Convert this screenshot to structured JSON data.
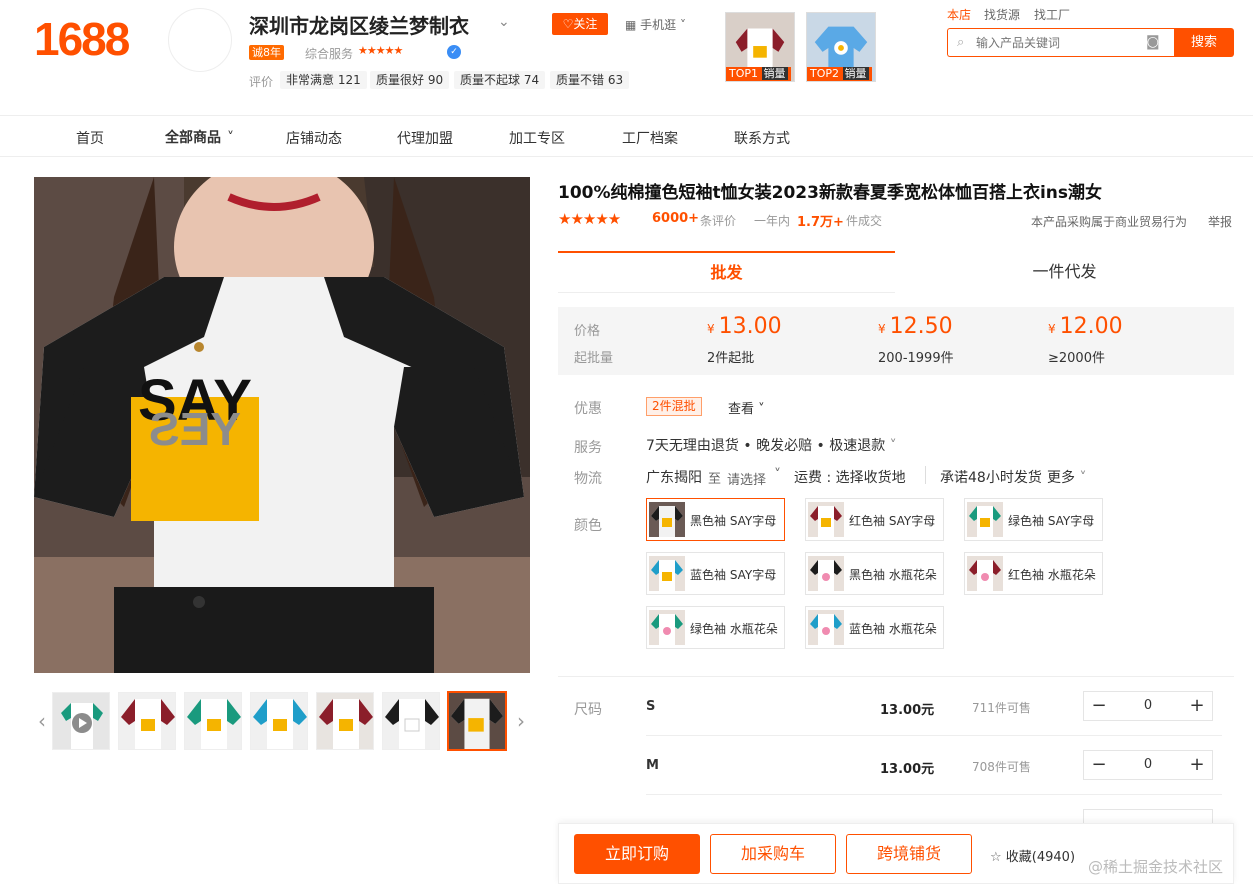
{
  "header": {
    "logo": "1688",
    "shop_name": "深圳市龙岗区绫兰梦制衣",
    "years_badge": "诚8年",
    "service_label": "综合服务",
    "service_stars": "★★★★★",
    "follow_label": "关注",
    "mobile_label": "手机逛",
    "review_label": "评价",
    "reviews": [
      "非常满意 121",
      "质量很好 90",
      "质量不起球 74",
      "质量不错 63"
    ],
    "top_items": [
      {
        "tag": "TOP1",
        "label": "销量"
      },
      {
        "tag": "TOP2",
        "label": "销量"
      }
    ],
    "search_scopes": [
      "本店",
      "找货源",
      "找工厂"
    ],
    "search_placeholder": "输入产品关键词",
    "search_button": "搜索"
  },
  "nav": {
    "items": [
      "首页",
      "全部商品",
      "店铺动态",
      "代理加盟",
      "加工专区",
      "工厂档案",
      "联系方式"
    ]
  },
  "product": {
    "title": "100%纯棉撞色短袖t恤女装2023新款春夏季宽松体恤百搭上衣ins潮女",
    "rating_stars": "★★★★★",
    "review_count": "6000+",
    "review_suffix": "条评价",
    "year_prefix": "一年内",
    "year_sales": "1.7万+",
    "deal_suffix": "件成交",
    "notice": "本产品采购属于商业贸易行为",
    "report": "举报",
    "tabs": [
      "批发",
      "一件代发"
    ],
    "price_label": "价格",
    "moq_label": "起批量",
    "currency": "¥",
    "tiers": [
      {
        "price": "13.00",
        "qty": "2件起批"
      },
      {
        "price": "12.50",
        "qty": "200-1999件"
      },
      {
        "price": "12.00",
        "qty": "≥2000件"
      }
    ],
    "promo_label": "优惠",
    "promo_tag": "2件混批",
    "promo_link": "查看",
    "service_label": "服务",
    "service_text": "7天无理由退货 • 晚发必赔 • 极速退款",
    "logistics_label": "物流",
    "origin": "广东揭阳",
    "to": "至",
    "dest": "请选择",
    "freight": "运费 : 选择收货地",
    "promise": "承诺48小时发货",
    "more": "更多",
    "color_label": "颜色",
    "colors": [
      "黑色袖 SAY字母",
      "红色袖 SAY字母",
      "绿色袖 SAY字母",
      "蓝色袖 SAY字母",
      "黑色袖 水瓶花朵",
      "红色袖 水瓶花朵",
      "绿色袖 水瓶花朵",
      "蓝色袖 水瓶花朵"
    ],
    "size_label": "尺码",
    "sizes": [
      {
        "name": "S",
        "price": "13.00元",
        "stock": "711件可售",
        "qty": "0"
      },
      {
        "name": "M",
        "price": "13.00元",
        "stock": "708件可售",
        "qty": "0"
      }
    ],
    "image_text": [
      "SAY",
      "YES"
    ]
  },
  "actions": {
    "order": "立即订购",
    "cart": "加采购车",
    "cross": "跨境铺货",
    "fav": "收藏(4940)"
  },
  "watermark": "@稀土掘金技术社区",
  "colors": {
    "accent": "#ff5000",
    "sleeve_black": "#1c1c1c",
    "sleeve_red": "#8b1e2a",
    "sleeve_green": "#1a9a7e",
    "sleeve_blue": "#1f9ec9",
    "print_yellow": "#f5b400"
  }
}
